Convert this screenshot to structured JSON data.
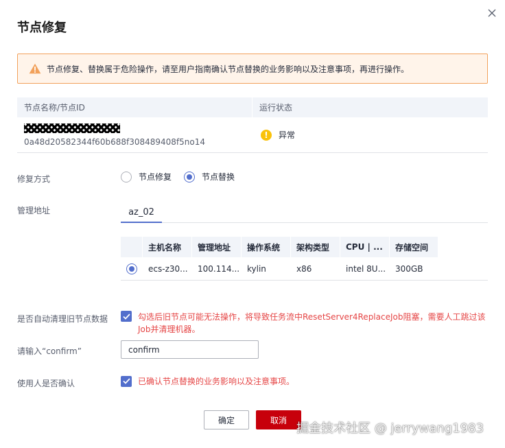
{
  "dialog": {
    "title": "节点修复"
  },
  "alert": {
    "icon": "warning-icon",
    "color": "#f2a15b",
    "text": "节点修复、替换属于危险操作，请至用户指南确认节点替换的业务影响以及注意事项，再进行操作。"
  },
  "node_table": {
    "headers": [
      "节点名称/节点ID",
      "运行状态"
    ],
    "rows": [
      {
        "node_id": "0a48d20582344f60b688f308489408f5no14",
        "status": "异常",
        "status_color": "#fac20a"
      }
    ]
  },
  "repair_method": {
    "label": "修复方式",
    "options": [
      {
        "label": "节点修复",
        "checked": false
      },
      {
        "label": "节点替换",
        "checked": true
      }
    ]
  },
  "mgmt_address": {
    "label": "管理地址",
    "tabs": [
      "az_02"
    ],
    "table": {
      "headers": [
        "主机名称",
        "管理地址",
        "操作系统",
        "架构类型",
        "CPU | ...",
        "存储空间"
      ],
      "rows": [
        {
          "selected": true,
          "cells": [
            "ecs-z30...",
            "100.114...",
            "kylin",
            "x86",
            "intel 8U...",
            "300GB"
          ]
        }
      ]
    }
  },
  "auto_cleanup": {
    "label": "是否自动清理旧节点数据",
    "checked": true,
    "warning": "勾选后旧节点可能无法操作，将导致任务流中ResetServer4ReplaceJob阻塞，需要人工跳过该Job并清理机器。"
  },
  "confirm_input": {
    "label": "请输入“confirm”",
    "value": "confirm"
  },
  "user_ack": {
    "label": "使用人是否确认",
    "checked": true,
    "warning": "已确认节点替换的业务影响以及注意事项。"
  },
  "buttons": {
    "ok": "确定",
    "cancel": "取消"
  },
  "watermark": "掘金技术社区 @ jerrywang1983",
  "colors": {
    "primary": "#526ecc",
    "danger": "#c7000b",
    "warning_text": "#e54545"
  }
}
